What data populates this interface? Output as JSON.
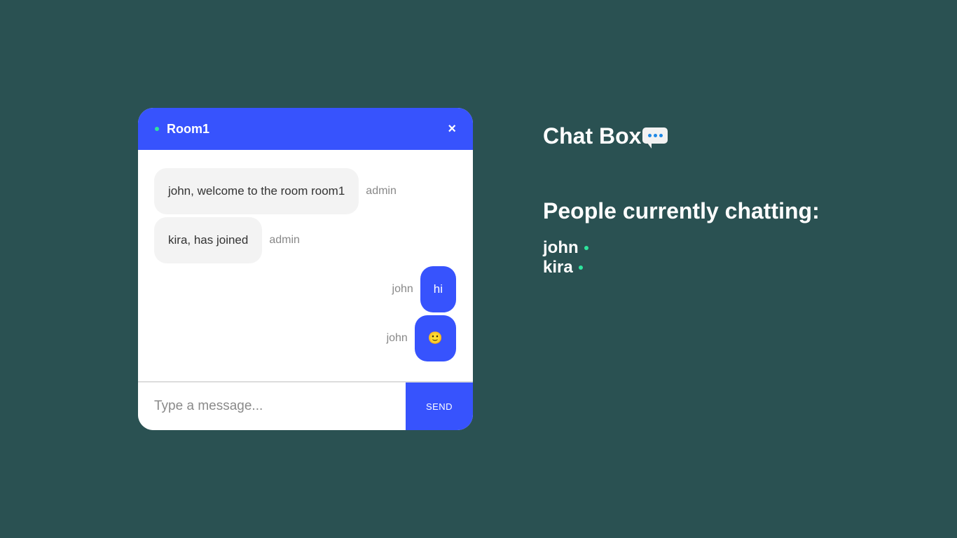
{
  "room": {
    "name": "Room1",
    "close_icon": "×"
  },
  "messages": [
    {
      "text": "john, welcome to the room room1",
      "sender": "admin",
      "side": "left"
    },
    {
      "text": "kira, has joined",
      "sender": "admin",
      "side": "left"
    },
    {
      "text": "hi",
      "sender": "john",
      "side": "right"
    },
    {
      "text": "🙂",
      "sender": "john",
      "side": "right"
    }
  ],
  "composer": {
    "placeholder": "Type a message...",
    "send_label": "SEND"
  },
  "side": {
    "title": "Chat Box",
    "title_icon": "speech-balloon-icon",
    "people_heading": "People currently chatting:",
    "people": [
      "john",
      "kira"
    ]
  },
  "colors": {
    "background": "#2a5152",
    "accent": "#3753fd",
    "online": "#2ee59d"
  }
}
